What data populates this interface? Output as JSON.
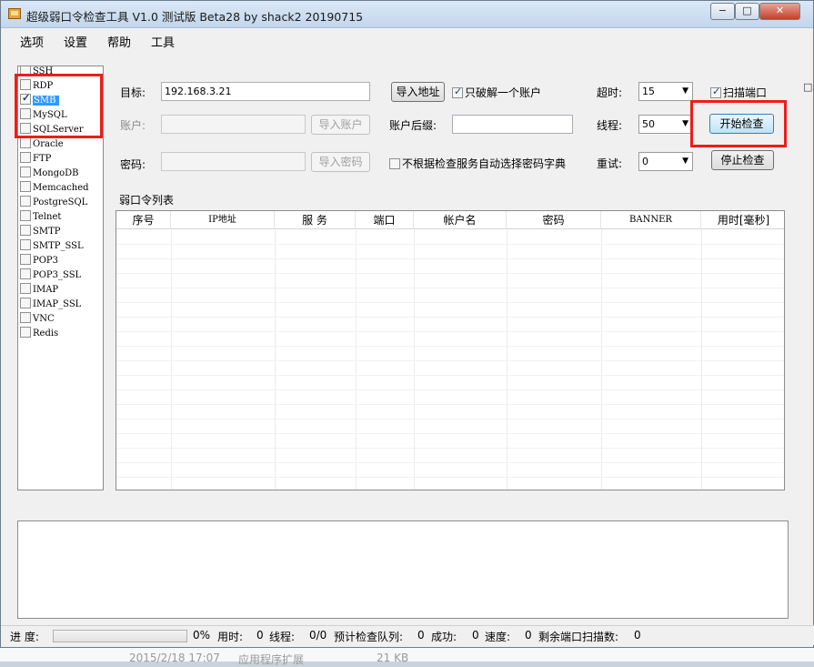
{
  "window": {
    "title": "超级弱口令检查工具 V1.0 测试版 Beta28 by shack2 20190715",
    "controls": {
      "minimize": "−",
      "maximize": "□",
      "close": "✕"
    }
  },
  "menu": [
    "选项",
    "设置",
    "帮助",
    "工具"
  ],
  "protocols": [
    {
      "label": "SSH",
      "checked": false,
      "selected": false
    },
    {
      "label": "RDP",
      "checked": false,
      "selected": false
    },
    {
      "label": "SMB",
      "checked": true,
      "selected": true
    },
    {
      "label": "MySQL",
      "checked": false,
      "selected": false
    },
    {
      "label": "SQLServer",
      "checked": false,
      "selected": false
    },
    {
      "label": "Oracle",
      "checked": false,
      "selected": false
    },
    {
      "label": "FTP",
      "checked": false,
      "selected": false
    },
    {
      "label": "MongoDB",
      "checked": false,
      "selected": false
    },
    {
      "label": "Memcached",
      "checked": false,
      "selected": false
    },
    {
      "label": "PostgreSQL",
      "checked": false,
      "selected": false
    },
    {
      "label": "Telnet",
      "checked": false,
      "selected": false
    },
    {
      "label": "SMTP",
      "checked": false,
      "selected": false
    },
    {
      "label": "SMTP_SSL",
      "checked": false,
      "selected": false
    },
    {
      "label": "POP3",
      "checked": false,
      "selected": false
    },
    {
      "label": "POP3_SSL",
      "checked": false,
      "selected": false
    },
    {
      "label": "IMAP",
      "checked": false,
      "selected": false
    },
    {
      "label": "IMAP_SSL",
      "checked": false,
      "selected": false
    },
    {
      "label": "VNC",
      "checked": false,
      "selected": false
    },
    {
      "label": "Redis",
      "checked": false,
      "selected": false
    }
  ],
  "form": {
    "target_label": "目标:",
    "target_value": "192.168.3.21",
    "import_address_button": "导入地址",
    "crack_one_label": "只破解一个账户",
    "crack_one_checked": true,
    "timeout_label": "超时:",
    "timeout_value": "15",
    "scan_port_label": "扫描端口",
    "scan_port_checked": true,
    "account_label": "账户:",
    "account_value": "",
    "import_account_button": "导入账户",
    "account_suffix_label": "账户后缀:",
    "account_suffix_value": "",
    "threads_label": "线程:",
    "threads_value": "50",
    "start_button": "开始检查",
    "password_label": "密码:",
    "password_value": "",
    "import_password_button": "导入密码",
    "auto_dict_label": "不根据检查服务自动选择密码字典",
    "auto_dict_checked": false,
    "retry_label": "重试:",
    "retry_value": "0",
    "stop_button": "停止检查"
  },
  "results": {
    "title": "弱口令列表",
    "columns": [
      "序号",
      "IP地址",
      "服 务",
      "端口",
      "帐户名",
      "密码",
      "BANNER",
      "用时[毫秒]"
    ],
    "rows": []
  },
  "log": "",
  "status": {
    "progress_label": "进 度:",
    "progress_fraction": 0,
    "percent": "0%",
    "elapsed_label": "用时:",
    "elapsed": "0",
    "threads_label": "线程:",
    "threads": "0/0",
    "queue_label": "预计检查队列:",
    "queue": "0",
    "success_label": "成功:",
    "success": "0",
    "speed_label": "速度:",
    "speed": "0",
    "remaining_label": "剩余端口扫描数:",
    "remaining": "0"
  },
  "background_strip": {
    "date": "2015/2/18 17:07",
    "type": "应用程序扩展",
    "size": "21 KB"
  },
  "colors": {
    "highlight": "#ee1c1c",
    "selection": "#3399ff"
  }
}
